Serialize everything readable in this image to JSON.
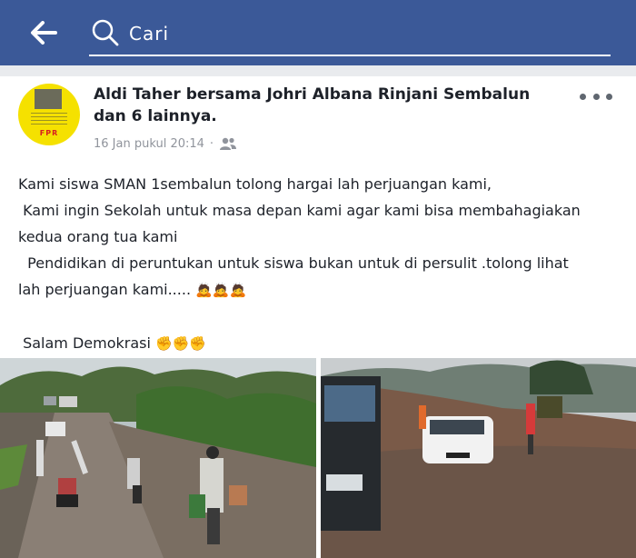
{
  "header": {
    "search_placeholder": "Cari",
    "back_icon": "arrow-left-icon",
    "search_icon": "search-icon",
    "bar_color": "#3b5998"
  },
  "post": {
    "author_line": "Aldi Taher bersama Johri Albana Rinjani Sembalun dan 6 lainnya.",
    "avatar_text": "FPR",
    "timestamp": "16 Jan pukul 20:14",
    "separator": "·",
    "audience_icon": "friends-icon",
    "more_icon": "more-horizontal-icon",
    "body_lines": [
      "Kami siswa SMAN 1sembalun tolong hargai lah perjuangan kami,",
      " Kami ingin Sekolah untuk masa depan kami agar kami bisa membahagiakan",
      "kedua orang tua kami",
      "  Pendidikan di peruntukan untuk siswa bukan untuk di persulit .tolong lihat",
      "lah perjuangan kami..... "
    ],
    "emoji_line5": "🙇🙇🙇",
    "greeting": " Salam Demokrasi ",
    "emoji_greeting": "✊✊✊"
  },
  "photos": [
    {
      "name": "muddy-road-students-photo"
    },
    {
      "name": "cars-stuck-in-mud-photo"
    }
  ]
}
